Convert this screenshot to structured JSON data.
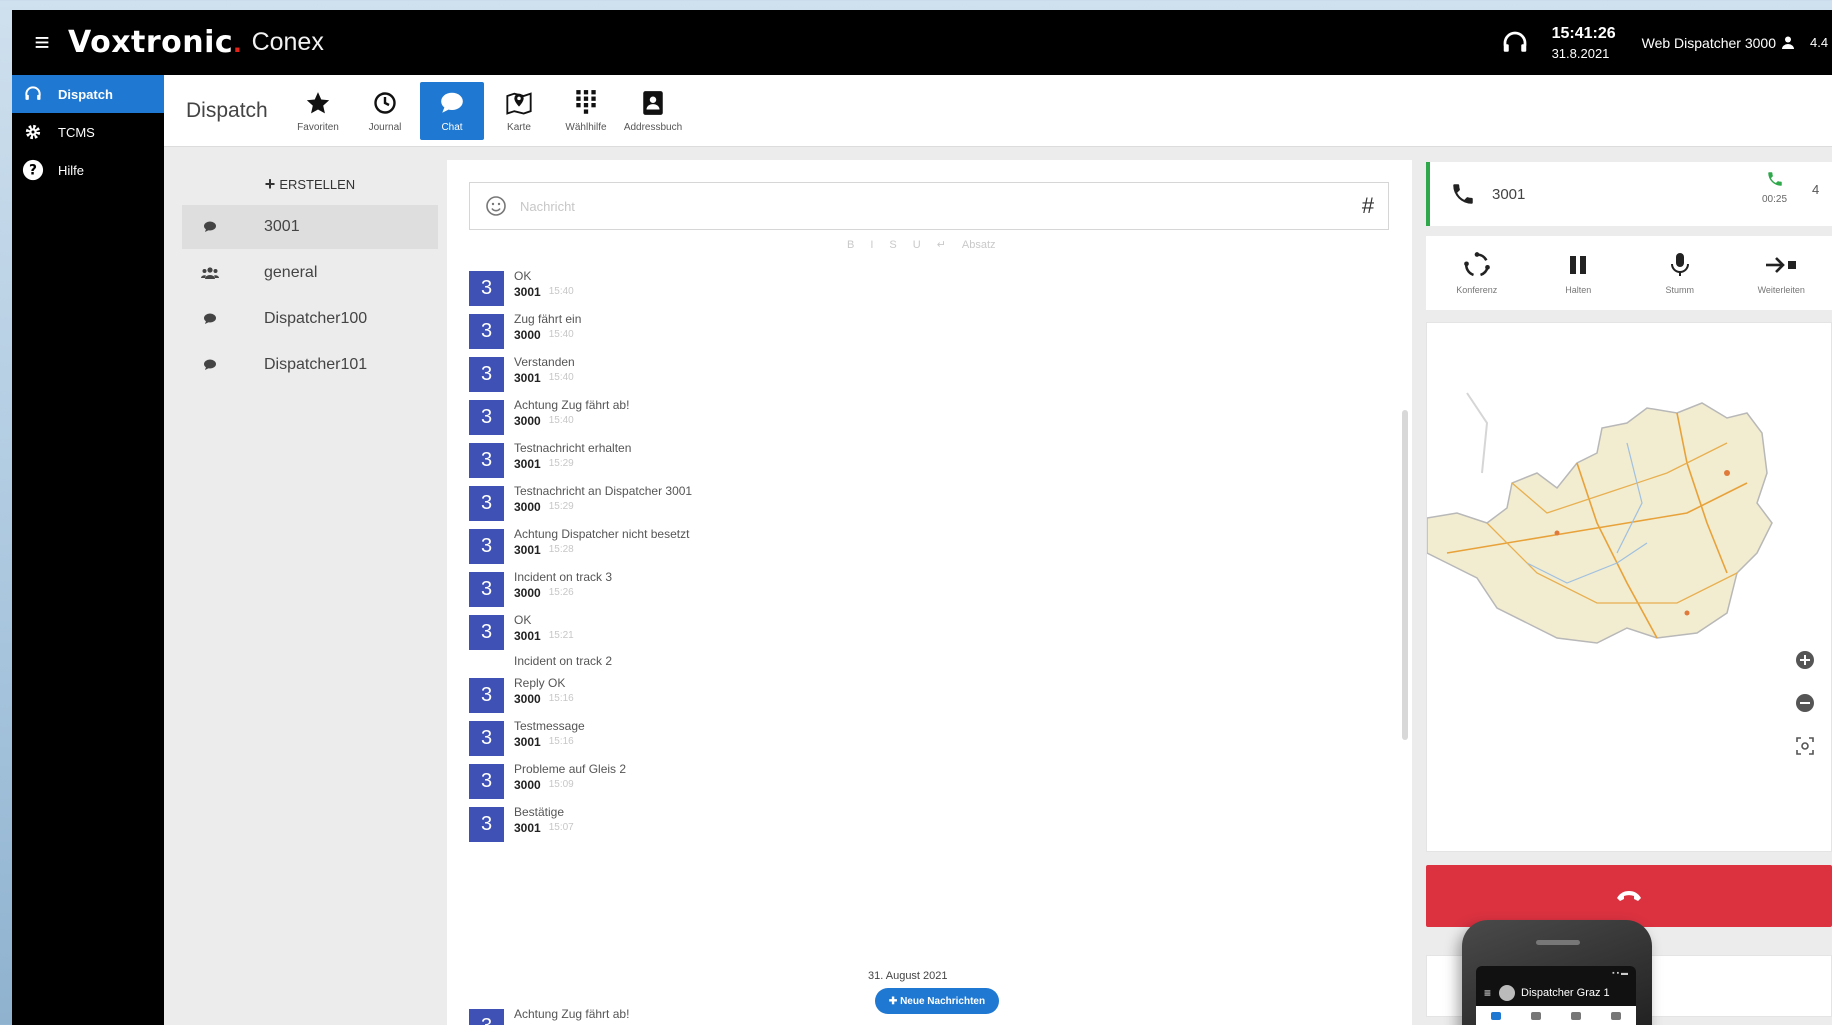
{
  "app": {
    "brand": "Voxtronic",
    "brand_dot": ".",
    "product": "Conex",
    "time": "15:41:26",
    "date": "31.8.2021",
    "user": "Web Dispatcher 3000",
    "version": "4.4"
  },
  "nav": {
    "items": [
      {
        "label": "Dispatch",
        "icon": "headset-icon"
      },
      {
        "label": "TCMS",
        "icon": "gear-icon"
      },
      {
        "label": "Hilfe",
        "icon": "help-icon"
      }
    ]
  },
  "toolbar": {
    "title": "Dispatch",
    "tools": [
      {
        "label": "Favoriten",
        "icon": "star-icon"
      },
      {
        "label": "Journal",
        "icon": "clock-icon"
      },
      {
        "label": "Chat",
        "icon": "chat-icon"
      },
      {
        "label": "Karte",
        "icon": "map-pin-icon"
      },
      {
        "label": "Wählhilfe",
        "icon": "dialpad-icon"
      },
      {
        "label": "Addressbuch",
        "icon": "contact-book-icon"
      }
    ]
  },
  "channels": {
    "create_label": "ERSTELLEN",
    "items": [
      {
        "label": "3001",
        "icon": "chat-bubble-icon"
      },
      {
        "label": "general",
        "icon": "group-icon"
      },
      {
        "label": "Dispatcher100",
        "icon": "chat-bubble-icon"
      },
      {
        "label": "Dispatcher101",
        "icon": "chat-bubble-icon"
      }
    ]
  },
  "chat": {
    "input_placeholder": "Nachricht",
    "hash_label": "#",
    "format_hint": "Absatz",
    "messages": [
      {
        "avatar": "3",
        "text": "OK",
        "sender": "3001",
        "time": "15:40"
      },
      {
        "avatar": "3",
        "text": "Zug fährt ein",
        "sender": "3000",
        "time": "15:40"
      },
      {
        "avatar": "3",
        "text": "Verstanden",
        "sender": "3001",
        "time": "15:40"
      },
      {
        "avatar": "3",
        "text": "Achtung Zug fährt ab!",
        "sender": "3000",
        "time": "15:40"
      },
      {
        "avatar": "3",
        "text": "Testnachricht erhalten",
        "sender": "3001",
        "time": "15:29"
      },
      {
        "avatar": "3",
        "text": "Testnachricht an Dispatcher 3001",
        "sender": "3000",
        "time": "15:29"
      },
      {
        "avatar": "3",
        "text": "Achtung Dispatcher nicht besetzt",
        "sender": "3001",
        "time": "15:28"
      },
      {
        "avatar": "3",
        "text": "Incident on track 3",
        "sender": "3000",
        "time": "15:26"
      },
      {
        "avatar": "3",
        "text": "OK",
        "sender": "3001",
        "time": "15:21"
      },
      {
        "avatar": "",
        "text": "Incident on track 2",
        "sender": "",
        "time": ""
      },
      {
        "avatar": "3",
        "text": "Reply OK",
        "sender": "3000",
        "time": "15:16"
      },
      {
        "avatar": "3",
        "text": "Testmessage",
        "sender": "3001",
        "time": "15:16"
      },
      {
        "avatar": "3",
        "text": "Probleme auf Gleis 2",
        "sender": "3000",
        "time": "15:09"
      },
      {
        "avatar": "3",
        "text": "Bestätige",
        "sender": "3001",
        "time": "15:07"
      },
      {
        "avatar": "3",
        "text": "Achtung Zug fährt ab!",
        "sender": "",
        "time": ""
      }
    ],
    "date_separator": "31. August 2021",
    "new_messages_label": "Neue Nachrichten"
  },
  "call": {
    "number": "3001",
    "duration": "00:25",
    "count": "4",
    "controls": [
      {
        "label": "Konferenz",
        "icon": "conference-icon"
      },
      {
        "label": "Halten",
        "icon": "pause-icon"
      },
      {
        "label": "Stumm",
        "icon": "microphone-icon"
      },
      {
        "label": "Weiterleiten",
        "icon": "forward-icon"
      }
    ]
  },
  "phone": {
    "title": "Dispatcher Graz 1"
  },
  "colors": {
    "accent": "#1f78d1",
    "avatar": "#3f51b5",
    "hangup": "#dc3240",
    "call_active": "#2ea84a"
  }
}
